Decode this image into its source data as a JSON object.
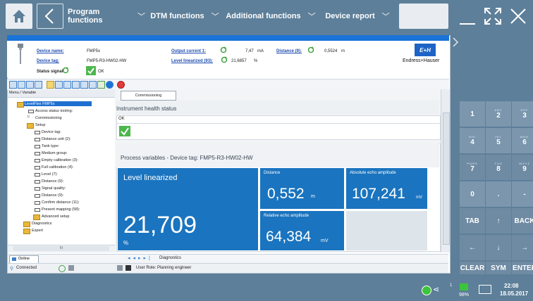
{
  "topbar": {
    "menus": [
      "Program functions",
      "DTM functions",
      "Additional functions",
      "Device report"
    ]
  },
  "device": {
    "name_label": "Device name:",
    "name_value": "FMP5x",
    "tag_label": "Device tag:",
    "tag_value": "FMP5-R3-HW02-HW",
    "status_label": "Status signal:",
    "status_value": "OK",
    "output_label": "Output current 1:",
    "output_value": "7,47",
    "output_unit": "mA",
    "level_label": "Level linearized (93):",
    "level_value": "21,6857",
    "level_unit": "%",
    "distance_label": "Distance (9):",
    "distance_value": "0,5524",
    "distance_unit": "m",
    "brand_logo": "E+H",
    "brand_name": "Endress+Hauser"
  },
  "tree": {
    "header": "Menu / Variable",
    "items": [
      "LevelFlex FMP5x",
      "Access status tooling:",
      "Commissioning",
      "Setup",
      "Device tag:",
      "Distance unit (2):",
      "Tank type:",
      "Medium group:",
      "Empty calibration (3):",
      "Full calibration (4):",
      "Level (7):",
      "Distance (9):",
      "Signal quality:",
      "Distance (9):",
      "Confirm distance (11):",
      "Present mapping (58):",
      "Advanced setup",
      "Diagnostics",
      "Expert"
    ]
  },
  "content": {
    "tab": "Commissioning",
    "health_title": "Instrument health status",
    "health_status": "OK",
    "process_title": "Process variables - Device tag: FMP5-R3-HW02-HW",
    "level_label": "Level linearized",
    "level_value": "21,709",
    "level_unit": "%",
    "distance_label": "Distance",
    "distance_value": "0,552",
    "distance_unit": "m",
    "abs_label": "Absolute echo amplitude",
    "abs_value": "107,241",
    "abs_unit": "mV",
    "rel_label": "Relative echo amplitude",
    "rel_value": "64,384",
    "rel_unit": "mV"
  },
  "bottom": {
    "online_tab": "Online",
    "nav_label": "Diagnostics",
    "connected": "Connected",
    "user_role": "User Role: Planning engineer",
    "hscroll_char": "III"
  },
  "keypad": [
    {
      "main": "1",
      "sub": ""
    },
    {
      "main": "2",
      "sub": "ABC"
    },
    {
      "main": "3",
      "sub": "DEF"
    },
    {
      "main": "4",
      "sub": "GHI"
    },
    {
      "main": "5",
      "sub": "JKL"
    },
    {
      "main": "6",
      "sub": "MNO"
    },
    {
      "main": "7",
      "sub": "PQRS"
    },
    {
      "main": "8",
      "sub": "TUV"
    },
    {
      "main": "9",
      "sub": "WXYZ"
    },
    {
      "main": "0",
      "sub": ""
    },
    {
      "main": ".",
      "sub": ""
    },
    {
      "main": "-",
      "sub": ""
    },
    {
      "main": "TAB",
      "sub": ""
    },
    {
      "main": "↑",
      "sub": ""
    },
    {
      "main": "BACK",
      "sub": ""
    },
    {
      "main": "←",
      "sub": ""
    },
    {
      "main": "↓",
      "sub": ""
    },
    {
      "main": "→",
      "sub": ""
    },
    {
      "main": "CLEAR",
      "sub": ""
    },
    {
      "main": "SYM",
      "sub": ""
    },
    {
      "main": "ENTER",
      "sub": ""
    }
  ],
  "taskbar": {
    "battery": "98%",
    "time": "22:08",
    "date": "18.05.2017",
    "network_count": "1"
  },
  "colors": {
    "accent_blue": "#1a73d9",
    "tile_blue": "#1a74bf",
    "ok_green": "#3fb33f",
    "chrome": "#5d7f99",
    "key_dark": "#7b96ad"
  }
}
